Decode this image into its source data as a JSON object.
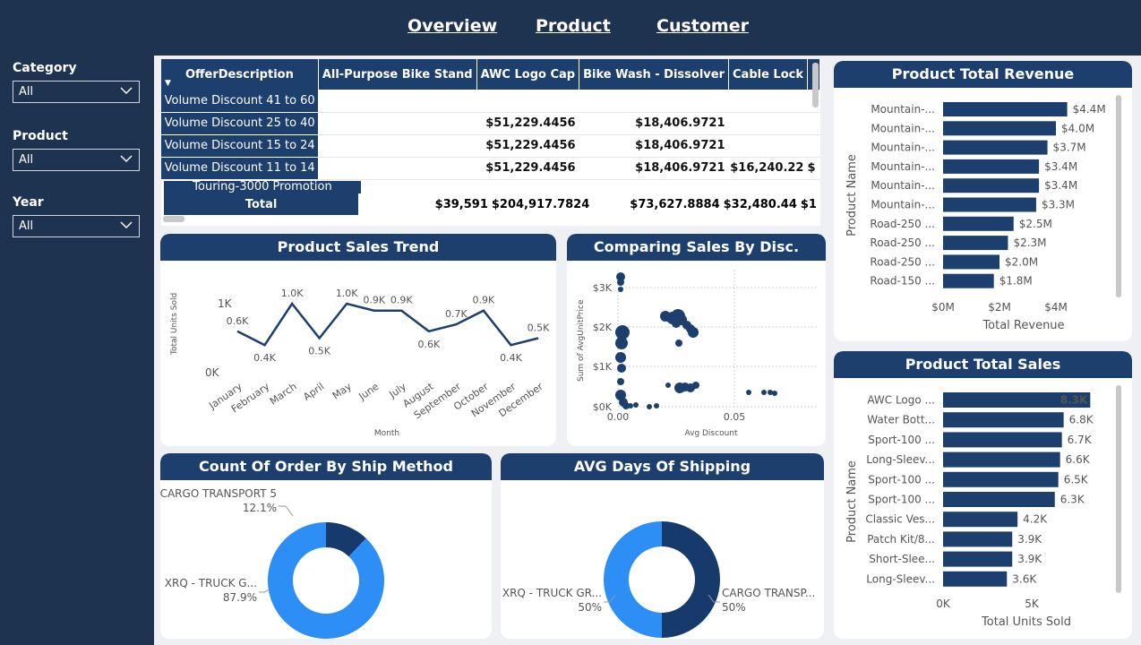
{
  "nav": [
    "Overview",
    "Product",
    "Customer"
  ],
  "filters": [
    {
      "label": "Category",
      "value": "All"
    },
    {
      "label": "Product",
      "value": "All"
    },
    {
      "label": "Year",
      "value": "All"
    }
  ],
  "matrix": {
    "headers": [
      "OfferDescription",
      "All-Purpose Bike Stand",
      "AWC Logo Cap",
      "Bike Wash - Dissolver",
      "Cable Lock"
    ],
    "rows": [
      {
        "label": "Volume Discount 41 to 60",
        "cells": [
          "",
          "",
          "",
          ""
        ]
      },
      {
        "label": "Volume Discount 25 to 40",
        "cells": [
          "",
          "$51,229.4456",
          "$18,406.9721",
          ""
        ]
      },
      {
        "label": "Volume Discount 15 to 24",
        "cells": [
          "",
          "$51,229.4456",
          "$18,406.9721",
          ""
        ]
      },
      {
        "label": "Volume Discount 11 to 14",
        "cells": [
          "",
          "$51,229.4456",
          "$18,406.9721",
          "$16,240.22"
        ]
      },
      {
        "label": "Touring-3000 Promotion",
        "cells": [
          "",
          "",
          "",
          ""
        ]
      }
    ],
    "total": {
      "label": "Total",
      "cells": [
        "$39,591",
        "$204,917.7824",
        "$73,627.8884",
        "$32,480.44"
      ]
    },
    "overflow_fragment": "$1",
    "overflow_dollar": "$"
  },
  "trend": {
    "title": "Product Sales Trend",
    "chart_data": {
      "type": "line",
      "categories": [
        "January",
        "February",
        "March",
        "April",
        "May",
        "June",
        "July",
        "August",
        "September",
        "October",
        "November",
        "December"
      ],
      "values": [
        0.6,
        0.4,
        1.0,
        0.5,
        1.0,
        0.9,
        0.9,
        0.6,
        0.7,
        0.9,
        0.4,
        0.5
      ],
      "value_labels": [
        "0.6K",
        "0.4K",
        "1.0K",
        "0.5K",
        "1.0K",
        "0.9K",
        "0.9K",
        "0.6K",
        "0.7K",
        "0.9K",
        "0.4K",
        "0.5K"
      ],
      "xlabel": "Month",
      "ylabel": "Total Units Sold",
      "yticks": [
        "0K",
        "1K"
      ],
      "color": "#1d3f6e"
    }
  },
  "scatter": {
    "title": "Comparing Sales By Disc.",
    "chart_data": {
      "type": "scatter",
      "xlabel": "Avg Discount",
      "ylabel": "Sum of AvgUnitPrice",
      "xticks": [
        "0.00",
        "0.05"
      ],
      "yticks": [
        "$0K",
        "$1K",
        "$2K",
        "$3K"
      ],
      "color": "#1d3f6e"
    }
  },
  "shipmethod": {
    "title": "Count Of Order By Ship Method",
    "chart_data": {
      "type": "pie",
      "labels": [
        "CARGO TRANSPORT 5",
        "XRQ - TRUCK G..."
      ],
      "percents": [
        "12.1%",
        "87.9%"
      ],
      "values": [
        12.1,
        87.9
      ],
      "colors": [
        "#163a6b",
        "#2d8ef5"
      ]
    }
  },
  "avgdays": {
    "title": "AVG Days Of Shipping",
    "chart_data": {
      "type": "pie",
      "labels": [
        "CARGO TRANSP...",
        "XRQ - TRUCK GR..."
      ],
      "percents": [
        "50%",
        "50%"
      ],
      "values": [
        50,
        50
      ],
      "colors": [
        "#163a6b",
        "#2d8ef5"
      ]
    }
  },
  "revenue": {
    "title": "Product Total Revenue",
    "chart_data": {
      "type": "bar",
      "categories": [
        "Mountain-...",
        "Mountain-...",
        "Mountain-...",
        "Mountain-...",
        "Mountain-...",
        "Mountain-...",
        "Road-250 ...",
        "Road-250 ...",
        "Road-250 ...",
        "Road-150 ..."
      ],
      "values": [
        4.4,
        4.0,
        3.7,
        3.4,
        3.4,
        3.3,
        2.5,
        2.3,
        2.0,
        1.8
      ],
      "value_labels": [
        "$4.4M",
        "$4.0M",
        "$3.7M",
        "$3.4M",
        "$3.4M",
        "$3.3M",
        "$2.5M",
        "$2.3M",
        "$2.0M",
        "$1.8M"
      ],
      "xlabel": "Total Revenue",
      "ylabel": "Product Name",
      "xticks": [
        "$0M",
        "$2M",
        "$4M"
      ],
      "xlim": [
        0,
        5
      ],
      "color": "#1d3f6e"
    }
  },
  "sales": {
    "title": "Product Total Sales",
    "chart_data": {
      "type": "bar",
      "categories": [
        "AWC Logo ...",
        "Water Bott...",
        "Sport-100 ...",
        "Long-Sleev...",
        "Sport-100 ...",
        "Sport-100 ...",
        "Classic Ves...",
        "Patch Kit/8...",
        "Short-Slee...",
        "Long-Sleev..."
      ],
      "values": [
        8.3,
        6.8,
        6.7,
        6.6,
        6.5,
        6.3,
        4.2,
        3.9,
        3.9,
        3.6
      ],
      "value_labels": [
        "8.3K",
        "6.8K",
        "6.7K",
        "6.6K",
        "6.5K",
        "6.3K",
        "4.2K",
        "3.9K",
        "3.9K",
        "3.6K"
      ],
      "xlabel": "Total Units Sold",
      "ylabel": "Product Name",
      "xticks": [
        "0K",
        "5K"
      ],
      "xlim": [
        0,
        10
      ],
      "color": "#1d3f6e"
    }
  }
}
